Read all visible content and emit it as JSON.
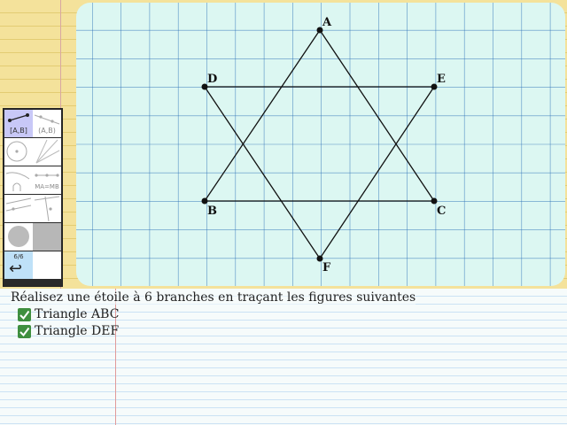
{
  "instructions": {
    "title": "Réalisez une étoile à 6 branches en traçant les figures suivantes",
    "tasks": [
      {
        "label": "Triangle ABC",
        "done": true
      },
      {
        "label": "Triangle DEF",
        "done": true
      }
    ]
  },
  "points": {
    "A": "A",
    "B": "B",
    "C": "C",
    "D": "D",
    "E": "E",
    "F": "F"
  },
  "toolbar": {
    "tools": [
      {
        "name": "segment-tool",
        "label": "[A,B]",
        "active": true
      },
      {
        "name": "ray-tool",
        "label": "(A,B)"
      },
      {
        "name": "circle-tool",
        "label": ""
      },
      {
        "name": "lines-tool",
        "label": ""
      },
      {
        "name": "arc-tool",
        "label": ""
      },
      {
        "name": "midpoint-tool",
        "label": "MA=MB"
      },
      {
        "name": "perpendicular-tool",
        "label": ""
      },
      {
        "name": "parallel-tool",
        "label": ""
      },
      {
        "name": "color-tool",
        "label": ""
      },
      {
        "name": "empty-tool",
        "label": ""
      },
      {
        "name": "page-indicator",
        "label": "6/6"
      },
      {
        "name": "undo-button",
        "label": ""
      }
    ]
  },
  "colors": {
    "grid_bg": "#dcf7f2",
    "grid_line": "#2a6fb6",
    "segment": "#111111",
    "check": "#3f8f3f",
    "active_tool": "#c8c8f7"
  }
}
